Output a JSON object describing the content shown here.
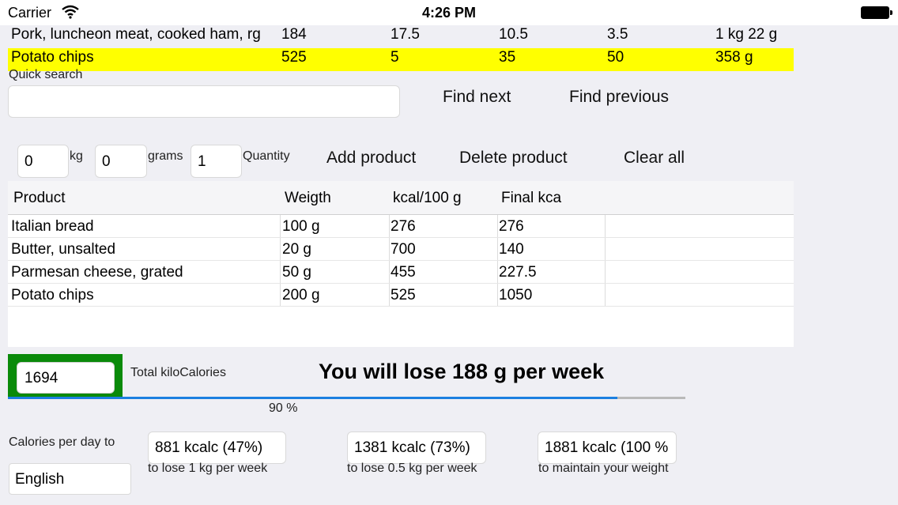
{
  "status_bar": {
    "carrier": "Carrier",
    "time": "4:26 PM",
    "wifi_icon": "wifi-icon",
    "battery_icon": "battery-icon"
  },
  "food_list": [
    {
      "name": "Pork, luncheon meat, cooked ham, rg",
      "kcal": "184",
      "protein": "17.5",
      "fat": "10.5",
      "carbs": "3.5",
      "limit": "1 kg 22 g",
      "highlighted": false
    },
    {
      "name": "Potato chips",
      "kcal": "525",
      "protein": "5",
      "fat": "35",
      "carbs": "50",
      "limit": "358 g",
      "highlighted": true
    }
  ],
  "highlight_color": "#ffff00",
  "quick_search": {
    "label": "Quick search",
    "value": ""
  },
  "buttons": {
    "find_next": "Find next",
    "find_previous": "Find previous",
    "add_product": "Add product",
    "delete_product": "Delete product",
    "clear_all": "Clear all"
  },
  "entry": {
    "kg_value": "0",
    "kg_label": "kg",
    "grams_value": "0",
    "grams_label": "grams",
    "quantity_value": "1",
    "quantity_label": "Quantity"
  },
  "table": {
    "headers": [
      "Product",
      "Weigth",
      "kcal/100 g",
      "Final kca",
      ""
    ],
    "rows": [
      [
        "Italian bread",
        "100 g",
        "276",
        "276"
      ],
      [
        "Butter, unsalted",
        "20 g",
        "700",
        "140"
      ],
      [
        "Parmesan cheese, grated",
        "50 g",
        "455",
        "227.5"
      ],
      [
        "Potato chips",
        "200 g",
        "525",
        "1050"
      ]
    ]
  },
  "total": {
    "value": "1694",
    "label": "Total kiloCalories",
    "box_color": "#0a8a0a"
  },
  "message": "You will lose 188 g per week",
  "progress": {
    "fraction": 0.9,
    "label": "90 %",
    "fill_color": "#1c7fe0"
  },
  "calories_per_day": {
    "label": "Calories per day to",
    "language": "English",
    "options": [
      {
        "value": "881 kcalc (47%)",
        "caption": "to lose 1 kg per week"
      },
      {
        "value": "1381 kcalc (73%)",
        "caption": "to lose 0.5 kg per week"
      },
      {
        "value": "1881 kcalc (100 %",
        "caption": "to maintain your weight"
      }
    ]
  }
}
